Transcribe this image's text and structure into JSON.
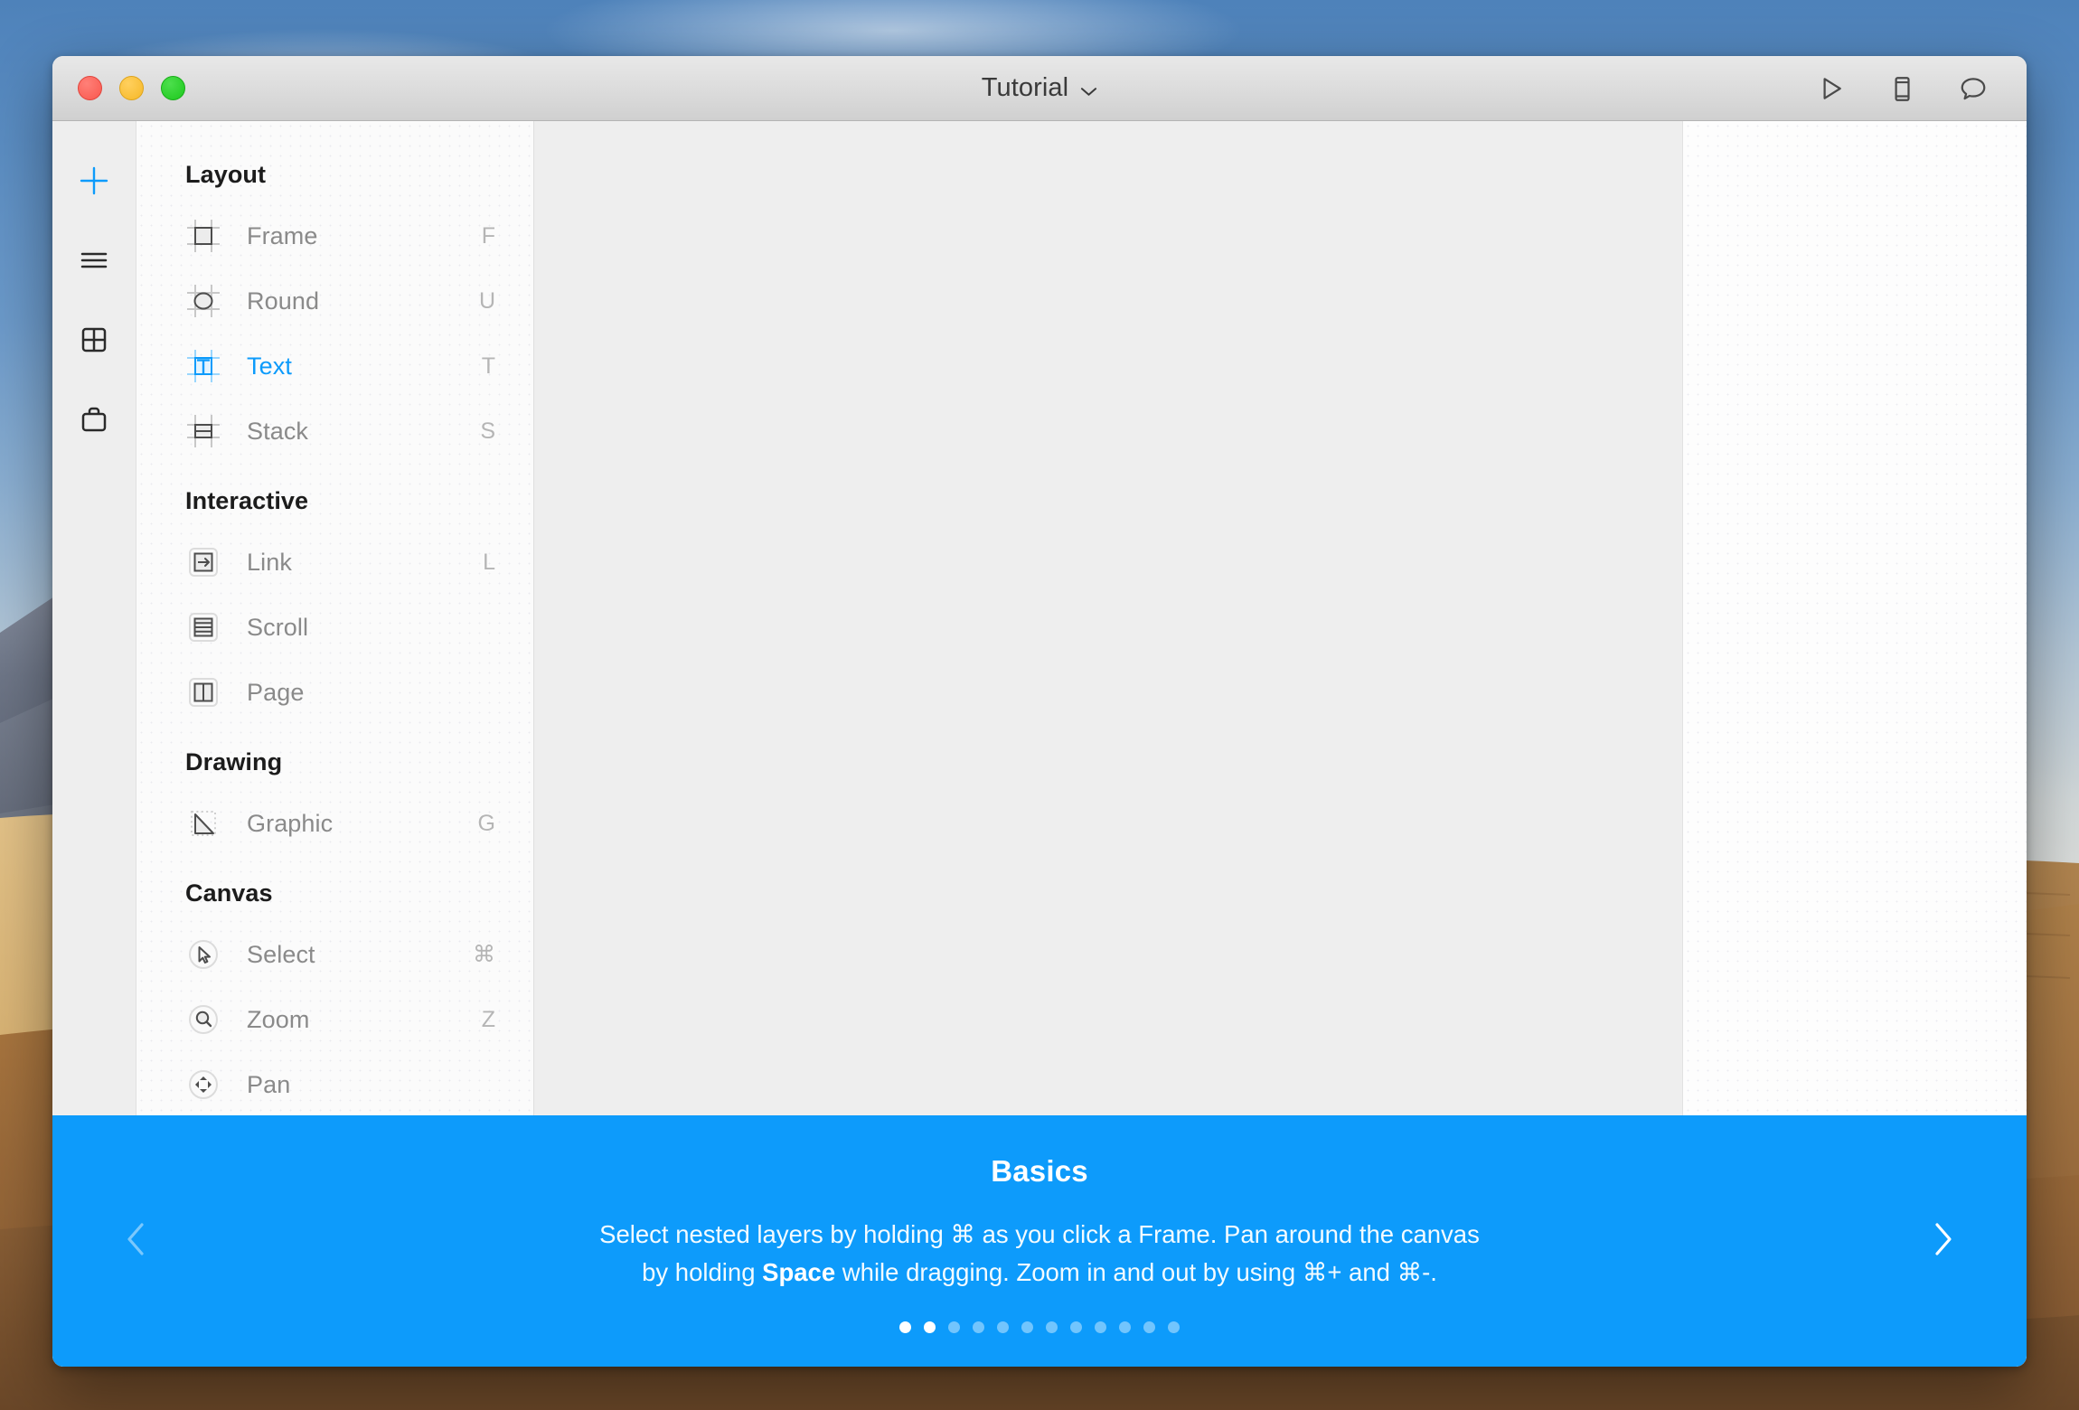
{
  "window": {
    "title": "Tutorial",
    "title_chevron_icon": "chevron-down-icon",
    "traffic_lights": [
      {
        "name": "close-button",
        "color": "#f9574d"
      },
      {
        "name": "minimize-button",
        "color": "#f6b828"
      },
      {
        "name": "zoom-button",
        "color": "#1dc81d"
      }
    ],
    "toolbar_right": [
      {
        "name": "preview-play-button",
        "icon": "play-icon"
      },
      {
        "name": "device-button",
        "icon": "device-phone-icon"
      },
      {
        "name": "comments-button",
        "icon": "speech-bubble-icon"
      }
    ]
  },
  "rail": {
    "items": [
      {
        "name": "sidebar-insert",
        "icon": "plus-icon",
        "active": true
      },
      {
        "name": "sidebar-layers",
        "icon": "list-lines-icon",
        "active": false
      },
      {
        "name": "sidebar-components",
        "icon": "grid-icon",
        "active": false
      },
      {
        "name": "sidebar-assets",
        "icon": "briefcase-icon",
        "active": false
      }
    ]
  },
  "panel": {
    "sections": [
      {
        "title": "Layout",
        "items": [
          {
            "label": "Frame",
            "key": "F",
            "icon": "frame-icon",
            "active": false
          },
          {
            "label": "Round",
            "key": "U",
            "icon": "round-icon",
            "active": false
          },
          {
            "label": "Text",
            "key": "T",
            "icon": "text-icon",
            "active": true
          },
          {
            "label": "Stack",
            "key": "S",
            "icon": "stack-icon",
            "active": false
          }
        ]
      },
      {
        "title": "Interactive",
        "items": [
          {
            "label": "Link",
            "key": "L",
            "icon": "link-icon",
            "active": false
          },
          {
            "label": "Scroll",
            "key": "",
            "icon": "scroll-icon",
            "active": false
          },
          {
            "label": "Page",
            "key": "",
            "icon": "page-icon",
            "active": false
          }
        ]
      },
      {
        "title": "Drawing",
        "items": [
          {
            "label": "Graphic",
            "key": "G",
            "icon": "graphic-icon",
            "active": false
          }
        ]
      },
      {
        "title": "Canvas",
        "items": [
          {
            "label": "Select",
            "key": "⌘",
            "icon": "cursor-arrow-icon",
            "active": false
          },
          {
            "label": "Zoom",
            "key": "Z",
            "icon": "magnifier-icon",
            "active": false
          },
          {
            "label": "Pan",
            "key": "",
            "icon": "hand-pan-icon",
            "active": false
          }
        ]
      }
    ]
  },
  "banner": {
    "title": "Basics",
    "line1": "Select nested layers by holding ⌘ as you click a Frame. Pan around the canvas",
    "line2_a": "by holding ",
    "line2_b": "Space",
    "line2_c": " while dragging. Zoom in and out by using ⌘+ and ⌘-.",
    "prev_icon": "chevron-left-icon",
    "next_icon": "chevron-right-icon",
    "accent_color": "#0d9bfb",
    "total_dots": 12,
    "active_dots": 2
  }
}
